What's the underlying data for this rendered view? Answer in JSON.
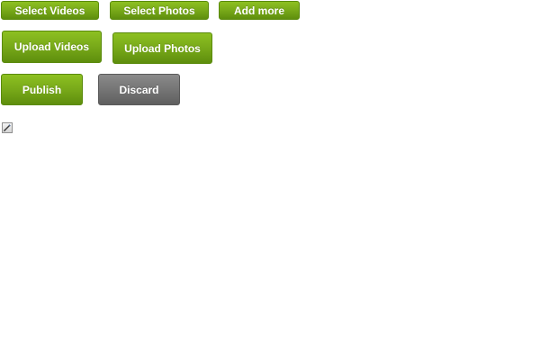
{
  "toolbar": {
    "select_videos_label": "Select Videos",
    "select_photos_label": "Select Photos",
    "add_more_label": "Add more"
  },
  "upload": {
    "upload_videos_label": "Upload Videos",
    "upload_photos_label": "Upload Photos"
  },
  "actions": {
    "publish_label": "Publish",
    "discard_label": "Discard"
  },
  "icons": {
    "edit": "pencil-icon"
  },
  "colors": {
    "primary_green": "#78a919",
    "secondary_gray": "#757575",
    "button_text": "#ffffff"
  }
}
